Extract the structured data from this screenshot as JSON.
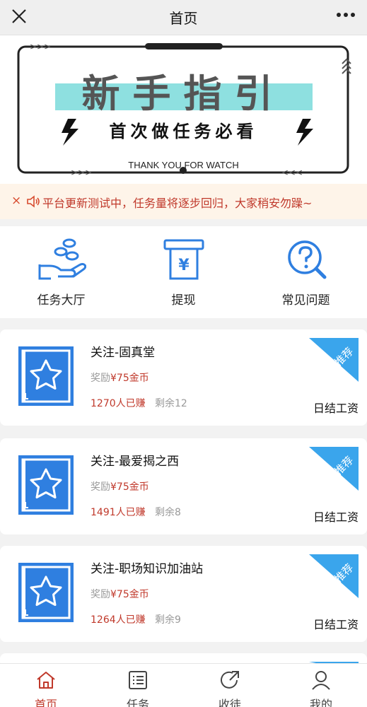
{
  "header": {
    "title": "首页",
    "close_icon": "close-icon",
    "more_icon": "more-icon"
  },
  "banner": {
    "title": "新手指引",
    "subtitle": "首次做任务必看",
    "footer": "THANK YOU FOR WATCH",
    "accent": "#8ee0e0"
  },
  "notice": {
    "close": "×",
    "text": "平台更新测试中，任务量将逐步回归，大家稍安勿躁~"
  },
  "quick": [
    {
      "label": "任务大厅",
      "icon": "coins-hand-icon"
    },
    {
      "label": "提现",
      "icon": "withdraw-icon"
    },
    {
      "label": "常见问题",
      "icon": "faq-icon"
    }
  ],
  "tasks": [
    {
      "name": "关注-固真堂",
      "reward_label": "奖励",
      "reward_value": "¥75金币",
      "earned": "1270人已赚",
      "remaining": "剩余12",
      "tag": "推荐",
      "settle": "日结工资"
    },
    {
      "name": "关注-最爱揭之西",
      "reward_label": "奖励",
      "reward_value": "¥75金币",
      "earned": "1491人已赚",
      "remaining": "剩余8",
      "tag": "推荐",
      "settle": "日结工资"
    },
    {
      "name": "关注-职场知识加油站",
      "reward_label": "奖励",
      "reward_value": "¥75金币",
      "earned": "1264人已赚",
      "remaining": "剩余9",
      "tag": "推荐",
      "settle": "日结工资"
    }
  ],
  "tabs": [
    {
      "label": "首页",
      "icon": "home-icon",
      "active": true
    },
    {
      "label": "任务",
      "icon": "list-icon",
      "active": false
    },
    {
      "label": "收徒",
      "icon": "share-icon",
      "active": false
    },
    {
      "label": "我的",
      "icon": "user-icon",
      "active": false
    }
  ],
  "colors": {
    "primary_blue": "#2f7fe0",
    "tag_blue": "#3aa5ec",
    "red_text": "#c0392b",
    "active_tab": "#c0392b"
  }
}
